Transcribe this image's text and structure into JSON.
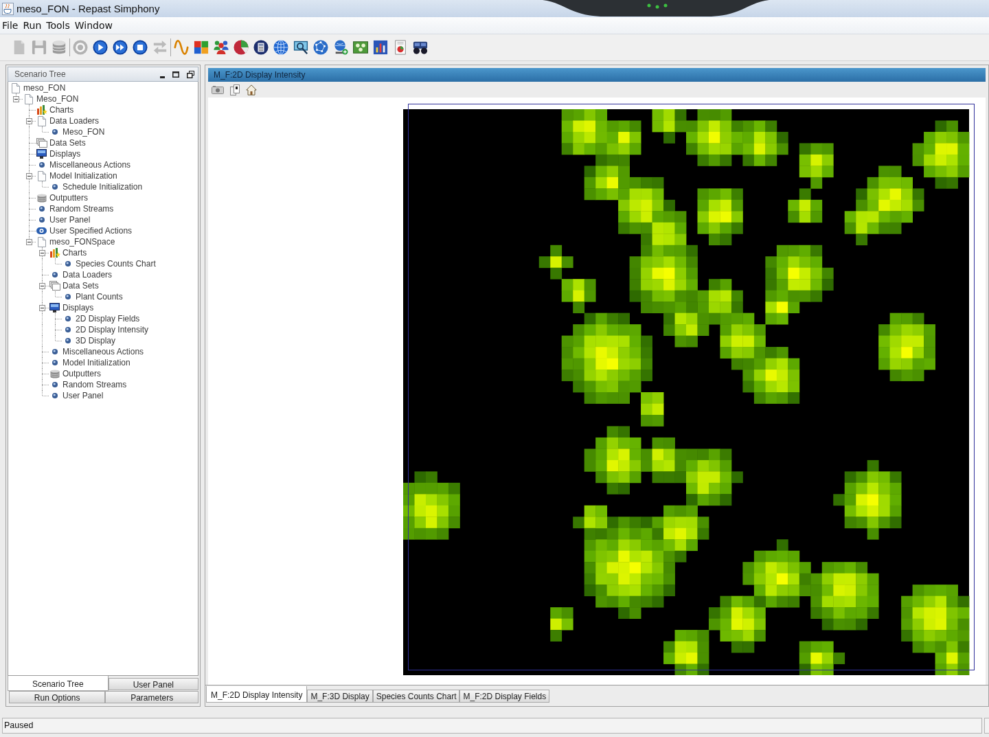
{
  "window": {
    "title": "meso_FON - Repast Simphony"
  },
  "menu": [
    "File",
    "Run",
    "Tools",
    "Window"
  ],
  "toolbar": {
    "groups": [
      [
        {
          "kind": "page",
          "disabled": true
        },
        {
          "kind": "floppy",
          "disabled": true
        },
        {
          "kind": "database",
          "disabled": false
        }
      ],
      [
        {
          "kind": "ring",
          "disabled": true
        },
        {
          "kind": "play",
          "disabled": false
        },
        {
          "kind": "fast-forward",
          "disabled": false
        },
        {
          "kind": "stop",
          "disabled": false
        },
        {
          "kind": "arrows",
          "disabled": true
        }
      ],
      [
        {
          "kind": "wave",
          "disabled": false
        },
        {
          "kind": "four-squares",
          "disabled": false
        },
        {
          "kind": "people",
          "disabled": false
        },
        {
          "kind": "pie-sphere",
          "disabled": false
        },
        {
          "kind": "calculator",
          "disabled": false
        },
        {
          "kind": "globe",
          "disabled": false
        },
        {
          "kind": "monitor-magnifier",
          "disabled": false
        },
        {
          "kind": "network-globe",
          "disabled": false
        },
        {
          "kind": "globe-plus",
          "disabled": false
        },
        {
          "kind": "dot-panel",
          "disabled": false
        },
        {
          "kind": "bar-panel",
          "disabled": false
        },
        {
          "kind": "pie-document",
          "disabled": false
        },
        {
          "kind": "binoculars",
          "disabled": false
        }
      ]
    ]
  },
  "scenario_tree": {
    "title": "Scenario Tree",
    "nodes": [
      {
        "label": "meso_FON",
        "kind": "page",
        "children": [
          {
            "label": "Meso_FON",
            "kind": "page",
            "expanded": true,
            "children": [
              {
                "label": "Charts",
                "kind": "chart"
              },
              {
                "label": "Data Loaders",
                "kind": "page",
                "expanded": true,
                "children": [
                  {
                    "label": "Meso_FON",
                    "kind": "item"
                  }
                ]
              },
              {
                "label": "Data Sets",
                "kind": "dataset"
              },
              {
                "label": "Displays",
                "kind": "display"
              },
              {
                "label": "Miscellaneous Actions",
                "kind": "item"
              },
              {
                "label": "Model Initialization",
                "kind": "page",
                "expanded": true,
                "children": [
                  {
                    "label": "Schedule Initialization",
                    "kind": "item"
                  }
                ]
              },
              {
                "label": "Outputters",
                "kind": "database"
              },
              {
                "label": "Random Streams",
                "kind": "item"
              },
              {
                "label": "User Panel",
                "kind": "item"
              },
              {
                "label": "User Specified Actions",
                "kind": "action"
              },
              {
                "label": "meso_FONSpace",
                "kind": "page",
                "expanded": true,
                "children": [
                  {
                    "label": "Charts",
                    "kind": "chart",
                    "expanded": true,
                    "children": [
                      {
                        "label": "Species Counts Chart",
                        "kind": "item"
                      }
                    ]
                  },
                  {
                    "label": "Data Loaders",
                    "kind": "item"
                  },
                  {
                    "label": "Data Sets",
                    "kind": "dataset",
                    "expanded": true,
                    "children": [
                      {
                        "label": "Plant Counts",
                        "kind": "item"
                      }
                    ]
                  },
                  {
                    "label": "Displays",
                    "kind": "display",
                    "expanded": true,
                    "children": [
                      {
                        "label": "2D Display Fields",
                        "kind": "item"
                      },
                      {
                        "label": "2D Display Intensity",
                        "kind": "item"
                      },
                      {
                        "label": "3D Display",
                        "kind": "item"
                      }
                    ]
                  },
                  {
                    "label": "Miscellaneous Actions",
                    "kind": "item"
                  },
                  {
                    "label": "Model Initialization",
                    "kind": "item"
                  },
                  {
                    "label": "Outputters",
                    "kind": "database"
                  },
                  {
                    "label": "Random Streams",
                    "kind": "item"
                  },
                  {
                    "label": "User Panel",
                    "kind": "item"
                  }
                ]
              }
            ]
          }
        ]
      }
    ]
  },
  "panel_tabs": [
    {
      "label": "Scenario Tree",
      "selected": true
    },
    {
      "label": "User Panel",
      "selected": false
    },
    {
      "label": "Run Options",
      "selected": false
    },
    {
      "label": "Parameters",
      "selected": false
    }
  ],
  "display": {
    "title": "M_F:2D Display Intensity"
  },
  "display_tabs": [
    {
      "label": "M_F:2D Display Intensity",
      "selected": true
    },
    {
      "label": "M_F:3D Display",
      "selected": false
    },
    {
      "label": "Species Counts Chart",
      "selected": false
    },
    {
      "label": "M_F:2D Display Fields",
      "selected": false
    }
  ],
  "status_bar": {
    "text": "Paused"
  }
}
